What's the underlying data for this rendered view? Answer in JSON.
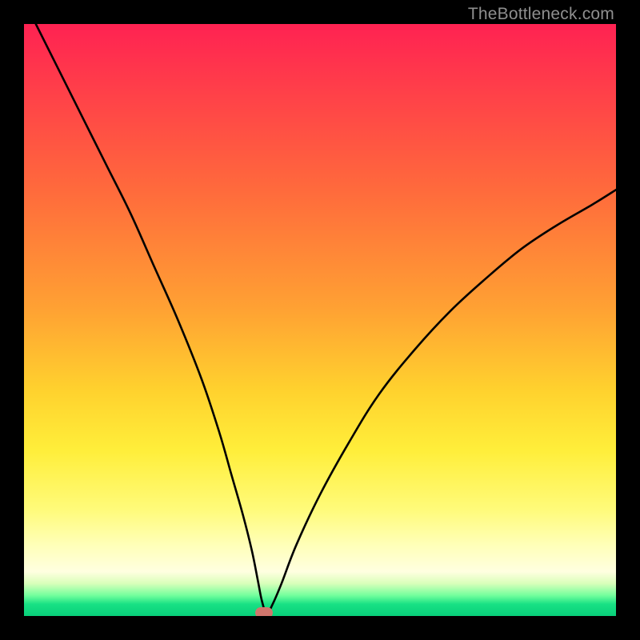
{
  "watermark": "TheBottleneck.com",
  "chart_data": {
    "type": "line",
    "title": "",
    "xlabel": "",
    "ylabel": "",
    "xlim": [
      0,
      100
    ],
    "ylim": [
      0,
      100
    ],
    "grid": false,
    "legend": false,
    "marker": {
      "x": 40.5,
      "u": 0.5
    },
    "series": [
      {
        "name": "bottleneck-curve",
        "x": [
          2,
          6,
          10,
          14,
          18,
          22,
          26,
          30,
          33,
          35,
          37,
          38.5,
          39.5,
          40.2,
          41,
          42,
          43.5,
          46,
          50,
          55,
          60,
          66,
          72,
          78,
          84,
          90,
          96,
          100
        ],
        "y": [
          100,
          92,
          84,
          76,
          68,
          59,
          50,
          40,
          31,
          24,
          17,
          11,
          6,
          2.5,
          0.4,
          2,
          5.5,
          12,
          20.5,
          29.5,
          37.5,
          45,
          51.5,
          57,
          62,
          66,
          69.5,
          72
        ]
      }
    ],
    "gradient_stops": [
      {
        "pos": 0,
        "color": "#ff2252"
      },
      {
        "pos": 10,
        "color": "#ff3c4a"
      },
      {
        "pos": 28,
        "color": "#ff6a3c"
      },
      {
        "pos": 48,
        "color": "#ffa133"
      },
      {
        "pos": 62,
        "color": "#ffd22e"
      },
      {
        "pos": 72,
        "color": "#ffee3a"
      },
      {
        "pos": 82,
        "color": "#fffb7a"
      },
      {
        "pos": 88,
        "color": "#ffffb8"
      },
      {
        "pos": 92.5,
        "color": "#ffffe0"
      },
      {
        "pos": 94.5,
        "color": "#d9ffba"
      },
      {
        "pos": 96.5,
        "color": "#74ff9d"
      },
      {
        "pos": 98,
        "color": "#18e184"
      },
      {
        "pos": 100,
        "color": "#09cf7a"
      }
    ]
  },
  "colors": {
    "frame": "#000000",
    "curve": "#000000",
    "marker": "#d1766d",
    "watermark": "#8f8f8f"
  }
}
